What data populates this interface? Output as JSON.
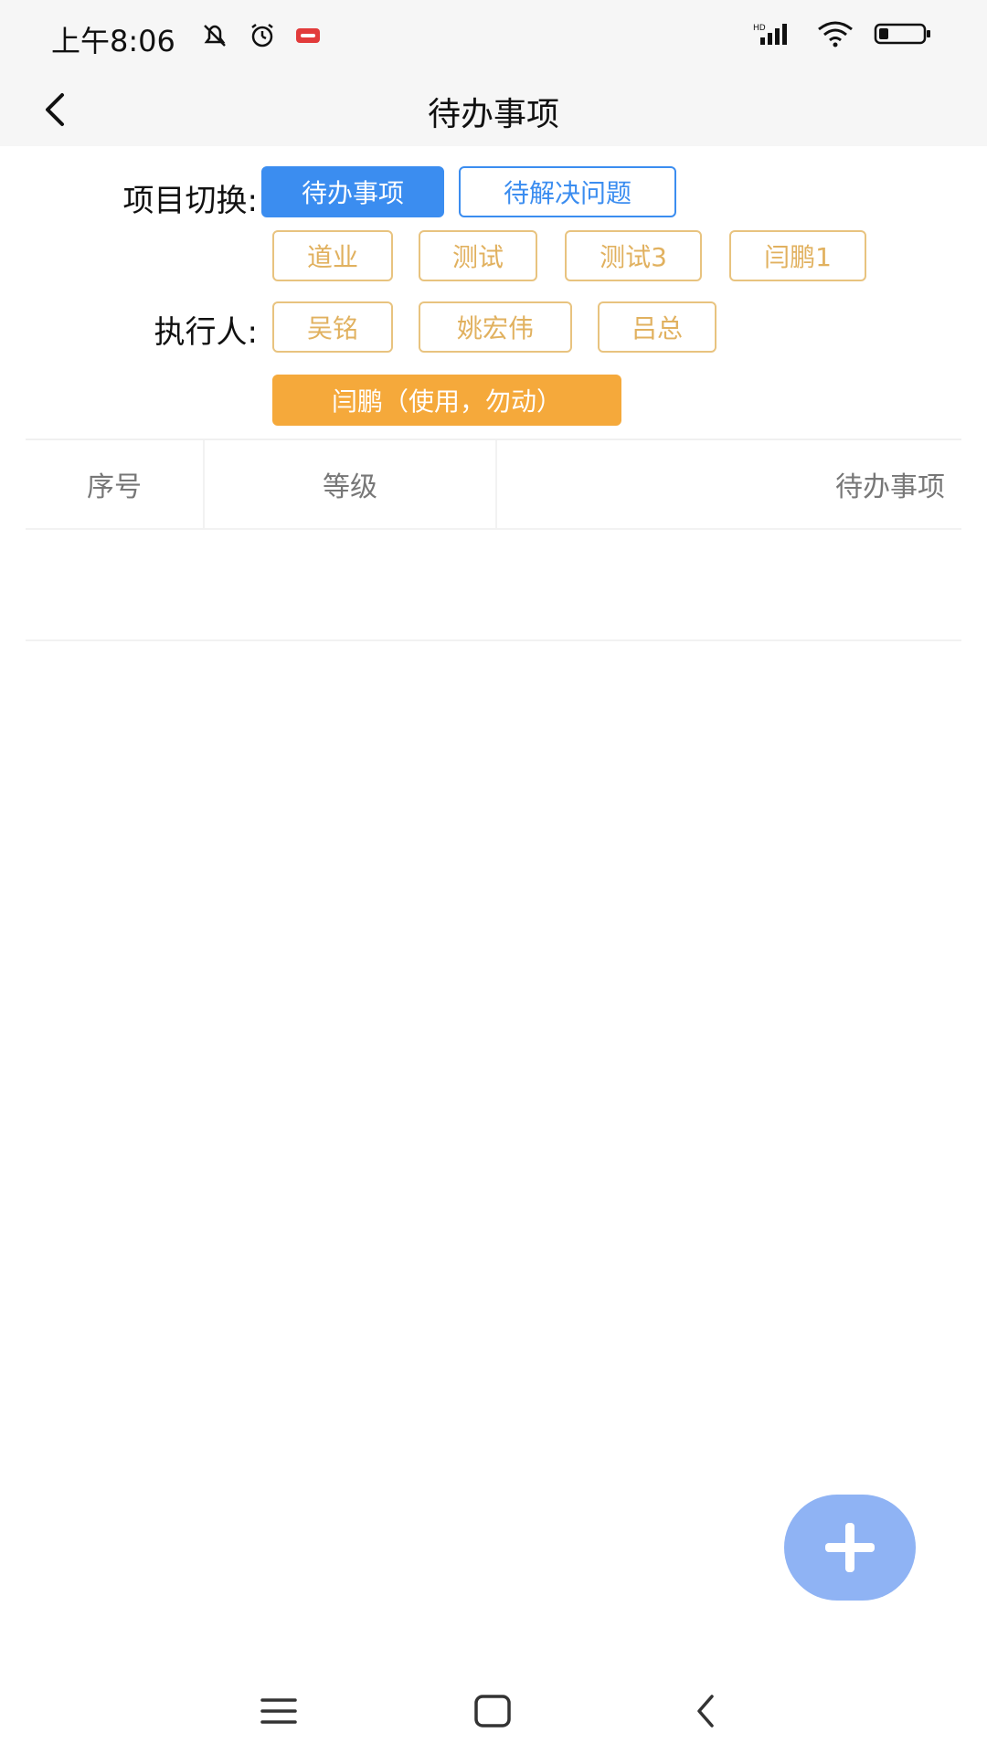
{
  "status_bar": {
    "time": "上午8:06",
    "icons_left": [
      "notifications-off-icon",
      "alarm-icon",
      "app-badge-icon"
    ],
    "icons_right": [
      "signal-icon",
      "wifi-icon",
      "battery-icon"
    ]
  },
  "header": {
    "title": "待办事项"
  },
  "filters": {
    "project_label": "项目切换:",
    "project_chips": [
      "待办事项",
      "待解决问题",
      "道业",
      "测试",
      "测试3",
      "闫鹏1"
    ],
    "executor_label": "执行人:",
    "executor_chips": [
      "吴铭",
      "姚宏伟",
      "吕总",
      "闫鹏（使用，勿动）"
    ]
  },
  "table": {
    "columns": [
      "序号",
      "等级",
      "待办事项"
    ],
    "rows": []
  },
  "fab": {
    "icon": "plus-icon"
  },
  "nav_bar": {
    "items": [
      "menu-icon",
      "home-icon",
      "back-icon"
    ]
  },
  "colors": {
    "primary": "#3b8df0",
    "chip_gold": "#e1b15f",
    "chip_orange": "#f5a93b",
    "fab": "#8fb3f4"
  }
}
